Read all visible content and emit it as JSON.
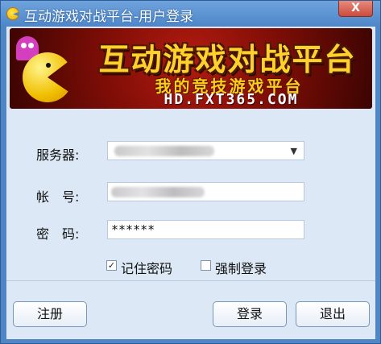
{
  "window": {
    "title": "互动游戏对战平台-用户登录",
    "close_label": "X"
  },
  "banner": {
    "title": "互动游戏对战平台",
    "subtitle": "我的竞技游戏平台",
    "url": "HD.FXT365.COM"
  },
  "form": {
    "server_label": "服务器:",
    "account_label": "帐　号:",
    "password_label": "密　码:",
    "password_value": "******",
    "remember_password_label": "记住密码",
    "force_login_label": "强制登录",
    "remember_password_checked": true,
    "force_login_checked": false
  },
  "buttons": {
    "register": "注册",
    "login": "登录",
    "exit": "退出"
  }
}
